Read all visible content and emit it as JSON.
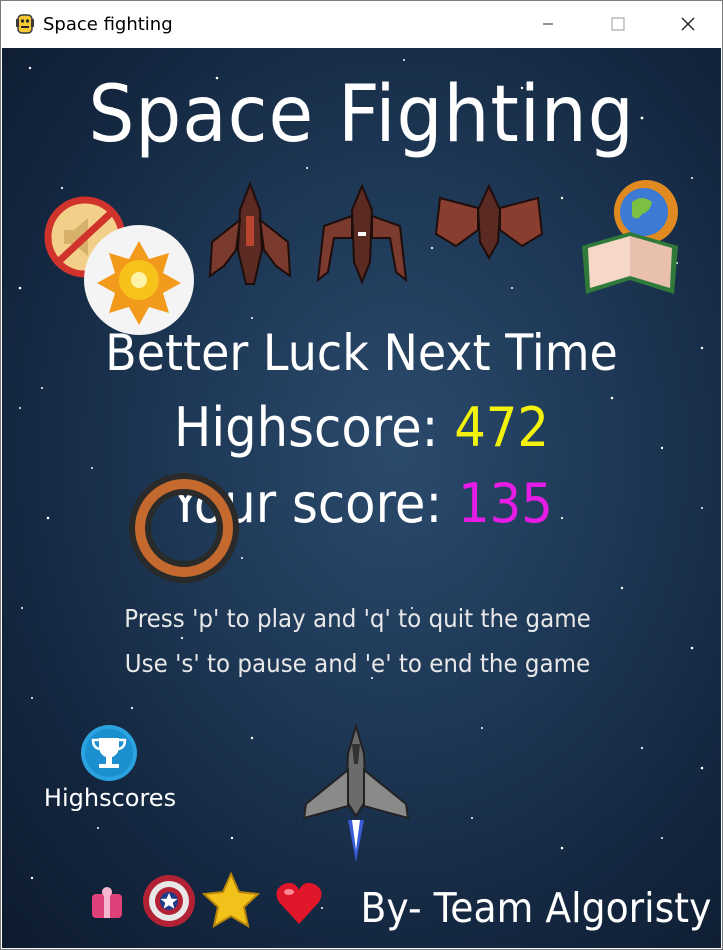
{
  "window": {
    "title": "Space fighting"
  },
  "game": {
    "title": "Space Fighting",
    "message": "Better Luck Next Time",
    "highscore_label": "Highscore: ",
    "highscore_value": "472",
    "yourscore_label": "Your score: ",
    "yourscore_value": "135",
    "instruction_1": "Press 'p' to play and 'q' to quit the game",
    "instruction_2": "Use 's' to pause and 'e' to end the game",
    "highscores_button": "Highscores",
    "credit": "By- Team Algoristy"
  },
  "colors": {
    "highscore": "#f2f20c",
    "yourscore": "#e61be6"
  },
  "icons": {
    "sound": "mute-icon",
    "explosion": "explosion-icon",
    "ships": [
      "enemy-ship-icon",
      "enemy-ship-icon",
      "enemy-ship-icon"
    ],
    "book": "globe-book-icon",
    "smoke": "smoke-ring-icon",
    "trophy": "trophy-icon",
    "player": "player-ship-icon",
    "powerups": [
      "gift-icon",
      "shield-icon",
      "star-icon",
      "heart-icon"
    ]
  }
}
